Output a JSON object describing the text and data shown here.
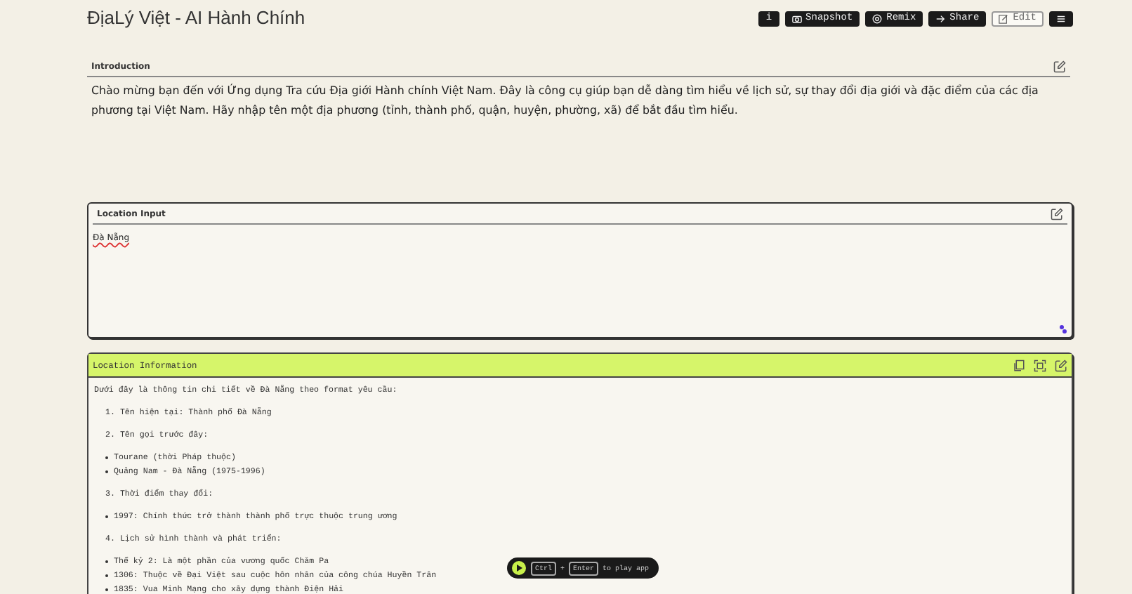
{
  "header": {
    "title": "ĐịaLý Việt - AI Hành Chính",
    "buttons": [
      {
        "kind": "info",
        "label": "i"
      },
      {
        "kind": "camera",
        "label": "Snapshot"
      },
      {
        "kind": "remix",
        "label": "Remix"
      },
      {
        "kind": "share",
        "label": "Share"
      },
      {
        "kind": "edit",
        "label": "Edit"
      },
      {
        "kind": "menu"
      }
    ]
  },
  "introduction": {
    "title": "Introduction",
    "text": "Chào mừng bạn đến với Ứng dụng Tra cứu Địa giới Hành chính Việt Nam. Đây là công cụ giúp bạn dễ dàng tìm hiểu về lịch sử, sự thay đổi địa giới và đặc điểm của các địa phương tại Việt Nam. Hãy nhập tên một địa phương (tỉnh, thành phố, quận, huyện, phường, xã) để bắt đầu tìm hiểu."
  },
  "location_input": {
    "title": "Location Input",
    "value": "Đà Nẵng"
  },
  "location_information": {
    "title": "Location Information",
    "blocks": [
      {
        "kind": "paragraph",
        "text": "Dưới đây là thông tin chi tiết về Đà Nẵng theo format yêu cầu:"
      },
      {
        "kind": "numbered",
        "number": "1.",
        "text": "Tên hiện tại: Thành phố Đà Nẵng"
      },
      {
        "kind": "numbered",
        "number": "2.",
        "text": "Tên gọi trước đây:"
      },
      {
        "kind": "bullets",
        "items": [
          "Tourane (thời Pháp thuộc)",
          "Quảng Nam - Đà Nẵng (1975-1996)"
        ]
      },
      {
        "kind": "numbered",
        "number": "3.",
        "text": "Thời điểm thay đổi:"
      },
      {
        "kind": "bullets",
        "items": [
          "1997: Chính thức trở thành thành phố trực thuộc trung ương"
        ]
      },
      {
        "kind": "numbered",
        "number": "4.",
        "text": "Lịch sử hình thành và phát triển:"
      },
      {
        "kind": "bullets",
        "items": [
          "Thế kỷ 2: Là một phần của vương quốc Chăm Pa",
          "1306: Thuộc về Đại Việt sau cuộc hôn nhân của công chúa Huyền Trân",
          "1835: Vua Minh Mạng cho xây dựng thành Điện Hải"
        ]
      }
    ]
  },
  "play_bar": {
    "keys": [
      "Ctrl",
      "Enter"
    ],
    "separator": "+",
    "text": "to play app"
  }
}
